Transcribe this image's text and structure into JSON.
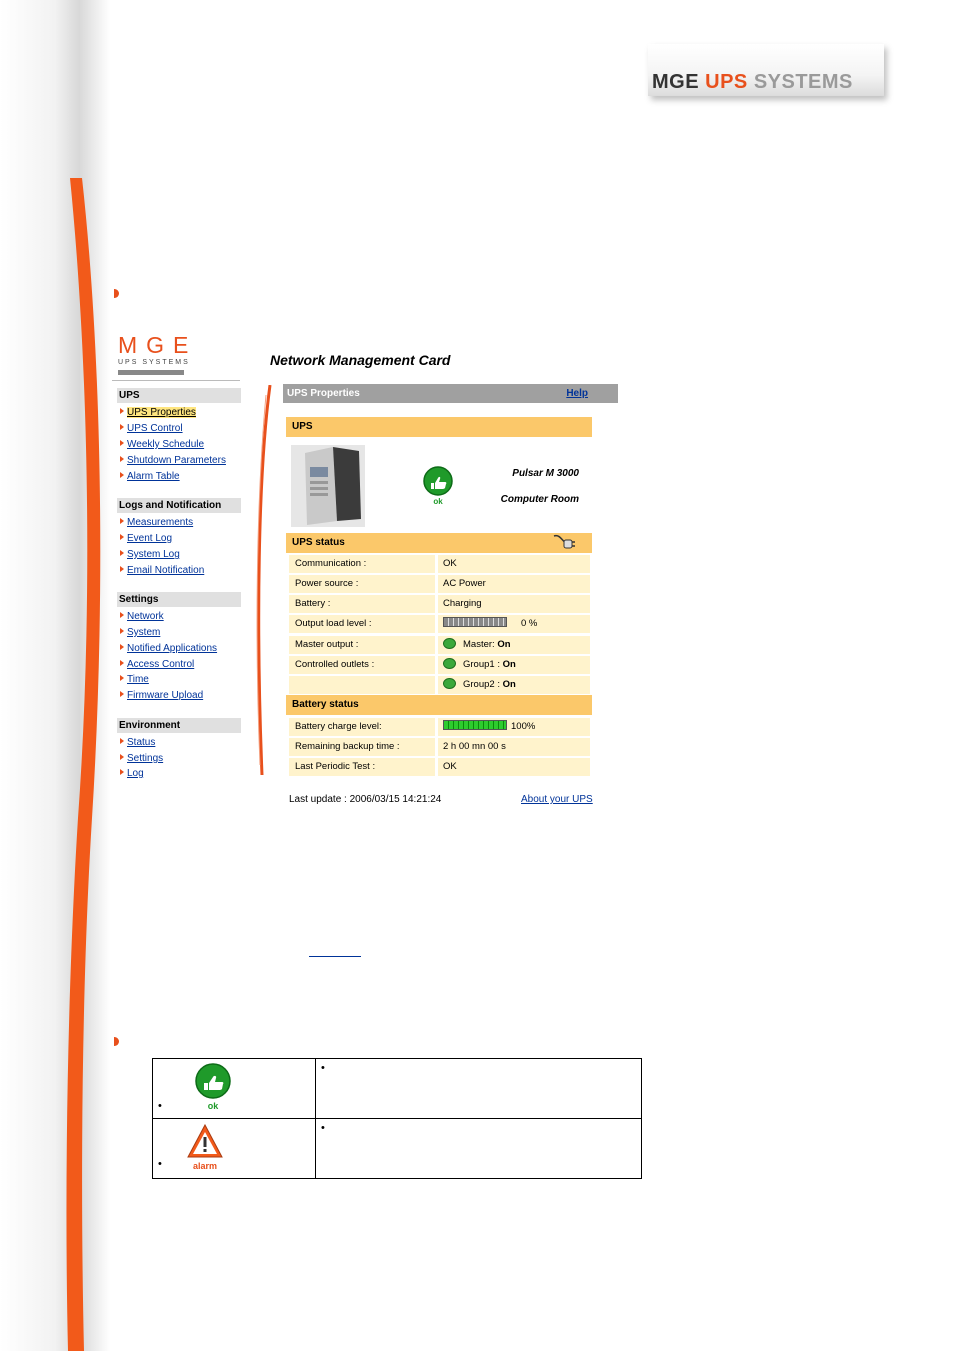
{
  "header": {
    "brand_mge": "MGE",
    "brand_ups": "UPS",
    "brand_systems": "SYSTEMS"
  },
  "card": {
    "logo_main": "MGE",
    "logo_sub": "UPS SYSTEMS",
    "title": "Network Management Card"
  },
  "nav": {
    "sections": [
      {
        "heading": "UPS",
        "items": [
          "UPS Properties",
          "UPS Control",
          "Weekly Schedule",
          "Shutdown Parameters",
          "Alarm Table"
        ]
      },
      {
        "heading": "Logs and Notification",
        "items": [
          "Measurements",
          "Event Log",
          "System Log",
          "Email Notification"
        ]
      },
      {
        "heading": "Settings",
        "items": [
          "Network",
          "System",
          "Notified Applications",
          "Access Control",
          "Time",
          "Firmware Upload"
        ]
      },
      {
        "heading": "Environment",
        "items": [
          "Status",
          "Settings",
          "Log"
        ]
      }
    ],
    "active_item": "UPS Properties"
  },
  "panel": {
    "title": "UPS Properties",
    "help_label": "Help",
    "ups_section": "UPS",
    "ok_label": "ok",
    "model": "Pulsar M 3000",
    "location": "Computer Room",
    "ups_status": {
      "heading": "UPS status",
      "communication_label": "Communication :",
      "communication_value": "OK",
      "power_source_label": "Power source :",
      "power_source_value": "AC Power",
      "battery_label": "Battery :",
      "battery_value": "Charging",
      "output_load_label": "Output load level :",
      "output_load_value": "0 %",
      "output_load_fraction": 0,
      "master_output_label": "Master output :",
      "master_name": "Master:",
      "master_state": "On",
      "controlled_outlets_label": "Controlled outlets :",
      "group1_name": "Group1 :",
      "group1_state": "On",
      "group2_name": "Group2 :",
      "group2_state": "On"
    },
    "battery_status": {
      "heading": "Battery status",
      "charge_label": "Battery charge level:",
      "charge_value": "100%",
      "charge_fraction": 1.0,
      "backup_label": "Remaining backup time :",
      "backup_value": "2 h 00 mn 00 s",
      "test_label": "Last Periodic Test :",
      "test_value": "OK"
    },
    "last_update": "Last update : 2006/03/15 14:21:24",
    "about_link": "About your UPS"
  },
  "legend": {
    "ok_label": "ok",
    "alarm_label": "alarm"
  },
  "colors": {
    "accent_orange": "#e8501c",
    "panel_gold": "#fbc86a",
    "row_cream": "#fff3cc",
    "link_blue": "#003399"
  }
}
